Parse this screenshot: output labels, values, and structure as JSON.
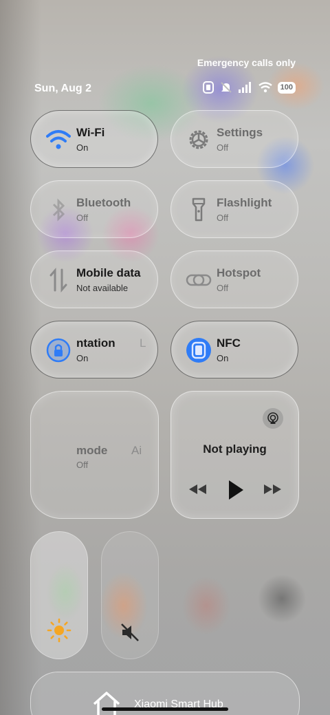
{
  "status_bar": {
    "carrier_text": "Emergency calls only",
    "date": "Sun, Aug 2",
    "battery": "100"
  },
  "tiles": [
    {
      "label": "Wi-Fi",
      "status": "On",
      "icon": "wifi-icon",
      "active": true
    },
    {
      "label": "Settings",
      "status": "Off",
      "icon": "gear-icon",
      "active": false
    },
    {
      "label": "Bluetooth",
      "status": "Off",
      "icon": "bluetooth-icon",
      "active": false
    },
    {
      "label": "Flashlight",
      "status": "Off",
      "icon": "flashlight-icon",
      "active": false
    },
    {
      "label": "Mobile data",
      "status": "Not available",
      "icon": "mobile-data-icon",
      "active": false
    },
    {
      "label": "Hotspot",
      "status": "Off",
      "icon": "hotspot-icon",
      "active": false
    },
    {
      "label": "ntation",
      "label_trail": "L",
      "status": "On",
      "icon": "rotation-lock-icon",
      "active": true
    },
    {
      "label": "NFC",
      "status": "On",
      "icon": "nfc-icon",
      "active": true
    }
  ],
  "mode_tile": {
    "label": "mode",
    "label_trail": "Ai",
    "status": "Off"
  },
  "media": {
    "title": "Not playing"
  },
  "colors": {
    "accent": "#2f7cf6",
    "brightness_icon": "#f5a623"
  },
  "hub": {
    "label": "Xiaomi Smart Hub"
  }
}
